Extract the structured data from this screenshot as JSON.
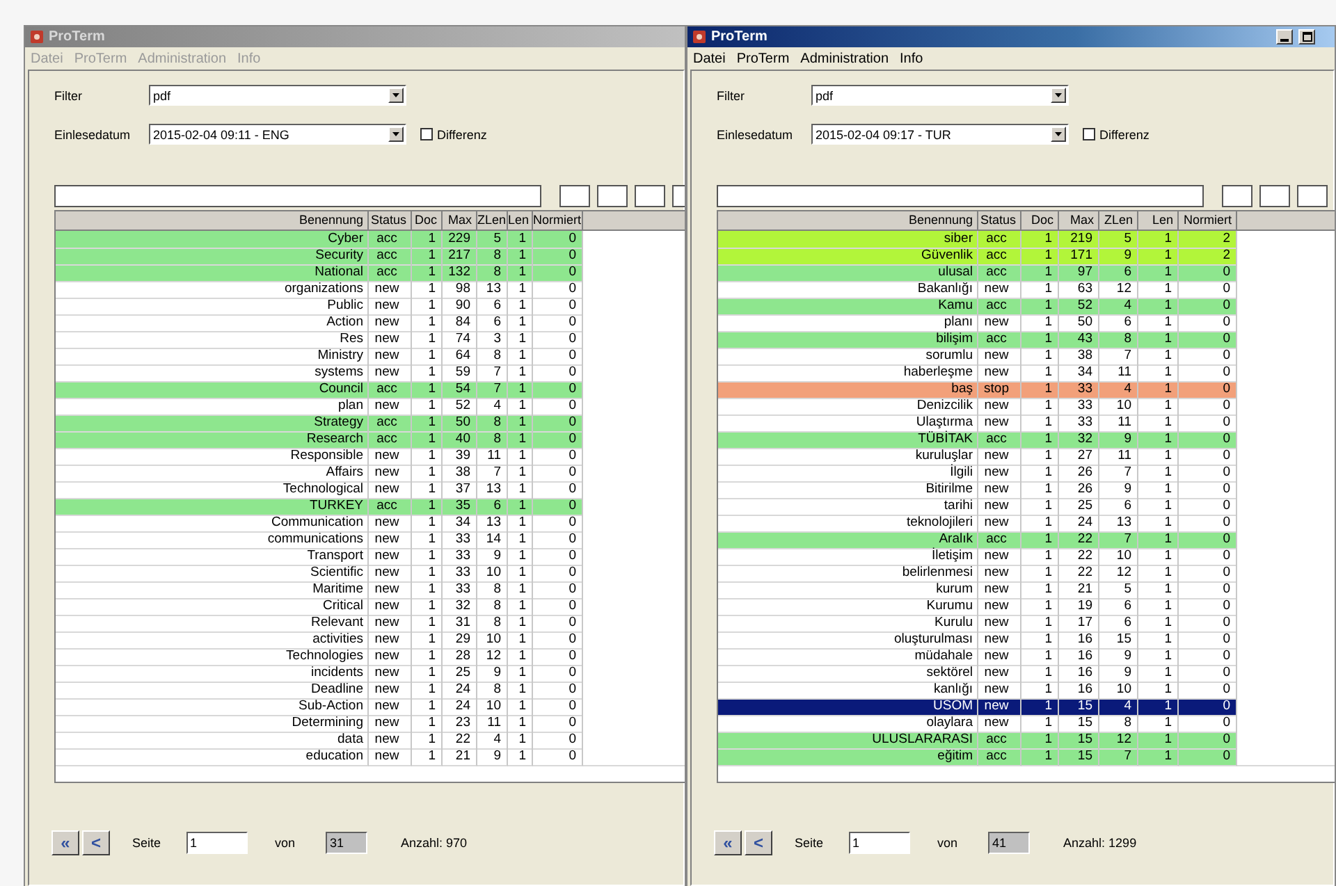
{
  "windows": [
    {
      "title": "ProTerm",
      "active": false,
      "menu": [
        "Datei",
        "ProTerm",
        "Administration",
        "Info"
      ],
      "filter": {
        "label": "Filter",
        "value": "pdf"
      },
      "date": {
        "label": "Einlesedatum",
        "value": "2015-02-04 09:11 - ENG"
      },
      "differenz": {
        "label": "Differenz",
        "checked": false
      },
      "columns": [
        "Benennung",
        "Status",
        "Doc",
        "Max",
        "ZLen",
        "Len",
        "Normiert"
      ],
      "rows": [
        {
          "cells": [
            "Cyber",
            "acc",
            "1",
            "229",
            "5",
            "1",
            "0"
          ],
          "color": "#8ee68e",
          "selected": false
        },
        {
          "cells": [
            "Security",
            "acc",
            "1",
            "217",
            "8",
            "1",
            "0"
          ],
          "color": "#8ee68e",
          "selected": false
        },
        {
          "cells": [
            "National",
            "acc",
            "1",
            "132",
            "8",
            "1",
            "0"
          ],
          "color": "#8ee68e",
          "selected": false
        },
        {
          "cells": [
            "organizations",
            "new",
            "1",
            "98",
            "13",
            "1",
            "0"
          ],
          "selected": false
        },
        {
          "cells": [
            "Public",
            "new",
            "1",
            "90",
            "6",
            "1",
            "0"
          ],
          "selected": false
        },
        {
          "cells": [
            "Action",
            "new",
            "1",
            "84",
            "6",
            "1",
            "0"
          ],
          "selected": false
        },
        {
          "cells": [
            "Res",
            "new",
            "1",
            "74",
            "3",
            "1",
            "0"
          ],
          "selected": false
        },
        {
          "cells": [
            "Ministry",
            "new",
            "1",
            "64",
            "8",
            "1",
            "0"
          ],
          "selected": false
        },
        {
          "cells": [
            "systems",
            "new",
            "1",
            "59",
            "7",
            "1",
            "0"
          ],
          "selected": false
        },
        {
          "cells": [
            "Council",
            "acc",
            "1",
            "54",
            "7",
            "1",
            "0"
          ],
          "color": "#8ee68e",
          "selected": false
        },
        {
          "cells": [
            "plan",
            "new",
            "1",
            "52",
            "4",
            "1",
            "0"
          ],
          "selected": false
        },
        {
          "cells": [
            "Strategy",
            "acc",
            "1",
            "50",
            "8",
            "1",
            "0"
          ],
          "color": "#8ee68e",
          "selected": false
        },
        {
          "cells": [
            "Research",
            "acc",
            "1",
            "40",
            "8",
            "1",
            "0"
          ],
          "color": "#8ee68e",
          "selected": false
        },
        {
          "cells": [
            "Responsible",
            "new",
            "1",
            "39",
            "11",
            "1",
            "0"
          ],
          "selected": false
        },
        {
          "cells": [
            "Affairs",
            "new",
            "1",
            "38",
            "7",
            "1",
            "0"
          ],
          "selected": false
        },
        {
          "cells": [
            "Technological",
            "new",
            "1",
            "37",
            "13",
            "1",
            "0"
          ],
          "selected": false
        },
        {
          "cells": [
            "TURKEY",
            "acc",
            "1",
            "35",
            "6",
            "1",
            "0"
          ],
          "color": "#8ee68e",
          "selected": false
        },
        {
          "cells": [
            "Communication",
            "new",
            "1",
            "34",
            "13",
            "1",
            "0"
          ],
          "selected": false
        },
        {
          "cells": [
            "communications",
            "new",
            "1",
            "33",
            "14",
            "1",
            "0"
          ],
          "selected": false
        },
        {
          "cells": [
            "Transport",
            "new",
            "1",
            "33",
            "9",
            "1",
            "0"
          ],
          "selected": false
        },
        {
          "cells": [
            "Scientific",
            "new",
            "1",
            "33",
            "10",
            "1",
            "0"
          ],
          "selected": false
        },
        {
          "cells": [
            "Maritime",
            "new",
            "1",
            "33",
            "8",
            "1",
            "0"
          ],
          "selected": false
        },
        {
          "cells": [
            "Critical",
            "new",
            "1",
            "32",
            "8",
            "1",
            "0"
          ],
          "selected": false
        },
        {
          "cells": [
            "Relevant",
            "new",
            "1",
            "31",
            "8",
            "1",
            "0"
          ],
          "selected": false
        },
        {
          "cells": [
            "activities",
            "new",
            "1",
            "29",
            "10",
            "1",
            "0"
          ],
          "selected": false
        },
        {
          "cells": [
            "Technologies",
            "new",
            "1",
            "28",
            "12",
            "1",
            "0"
          ],
          "selected": false
        },
        {
          "cells": [
            "incidents",
            "new",
            "1",
            "25",
            "9",
            "1",
            "0"
          ],
          "selected": false
        },
        {
          "cells": [
            "Deadline",
            "new",
            "1",
            "24",
            "8",
            "1",
            "0"
          ],
          "selected": false
        },
        {
          "cells": [
            "Sub-Action",
            "new",
            "1",
            "24",
            "10",
            "1",
            "0"
          ],
          "selected": false
        },
        {
          "cells": [
            "Determining",
            "new",
            "1",
            "23",
            "11",
            "1",
            "0"
          ],
          "selected": false
        },
        {
          "cells": [
            "data",
            "new",
            "1",
            "22",
            "4",
            "1",
            "0"
          ],
          "selected": false
        },
        {
          "cells": [
            "education",
            "new",
            "1",
            "21",
            "9",
            "1",
            "0"
          ],
          "selected": false
        }
      ],
      "nav": [
        "«",
        "<"
      ],
      "pager": {
        "page_label": "Seite",
        "page": "1",
        "of_label": "von",
        "total": "31",
        "count": "Anzahl: 970"
      }
    },
    {
      "title": "ProTerm",
      "active": true,
      "menu": [
        "Datei",
        "ProTerm",
        "Administration",
        "Info"
      ],
      "filter": {
        "label": "Filter",
        "value": "pdf"
      },
      "date": {
        "label": "Einlesedatum",
        "value": "2015-02-04 09:17 - TUR"
      },
      "differenz": {
        "label": "Differenz",
        "checked": false
      },
      "columns": [
        "Benennung",
        "Status",
        "Doc",
        "Max",
        "ZLen",
        "Len",
        "Normiert"
      ],
      "rows": [
        {
          "cells": [
            "siber",
            "acc",
            "1",
            "219",
            "5",
            "1",
            "2"
          ],
          "color": "#b2f53a",
          "selected": false
        },
        {
          "cells": [
            "Güvenlik",
            "acc",
            "1",
            "171",
            "9",
            "1",
            "2"
          ],
          "color": "#b2f53a",
          "selected": false
        },
        {
          "cells": [
            "ulusal",
            "acc",
            "1",
            "97",
            "6",
            "1",
            "0"
          ],
          "color": "#8ee68e",
          "selected": false
        },
        {
          "cells": [
            "Bakanlığı",
            "new",
            "1",
            "63",
            "12",
            "1",
            "0"
          ],
          "selected": false
        },
        {
          "cells": [
            "Kamu",
            "acc",
            "1",
            "52",
            "4",
            "1",
            "0"
          ],
          "color": "#8ee68e",
          "selected": false
        },
        {
          "cells": [
            "planı",
            "new",
            "1",
            "50",
            "6",
            "1",
            "0"
          ],
          "selected": false
        },
        {
          "cells": [
            "bilişim",
            "acc",
            "1",
            "43",
            "8",
            "1",
            "0"
          ],
          "color": "#8ee68e",
          "selected": false
        },
        {
          "cells": [
            "sorumlu",
            "new",
            "1",
            "38",
            "7",
            "1",
            "0"
          ],
          "selected": false
        },
        {
          "cells": [
            "haberleşme",
            "new",
            "1",
            "34",
            "11",
            "1",
            "0"
          ],
          "selected": false
        },
        {
          "cells": [
            "baş",
            "stop",
            "1",
            "33",
            "4",
            "1",
            "0"
          ],
          "color": "#f2a07a",
          "selected": false
        },
        {
          "cells": [
            "Denizcilik",
            "new",
            "1",
            "33",
            "10",
            "1",
            "0"
          ],
          "selected": false
        },
        {
          "cells": [
            "Ulaştırma",
            "new",
            "1",
            "33",
            "11",
            "1",
            "0"
          ],
          "selected": false
        },
        {
          "cells": [
            "TÜBİTAK",
            "acc",
            "1",
            "32",
            "9",
            "1",
            "0"
          ],
          "color": "#8ee68e",
          "selected": false
        },
        {
          "cells": [
            "kuruluşlar",
            "new",
            "1",
            "27",
            "11",
            "1",
            "0"
          ],
          "selected": false
        },
        {
          "cells": [
            "İlgili",
            "new",
            "1",
            "26",
            "7",
            "1",
            "0"
          ],
          "selected": false
        },
        {
          "cells": [
            "Bitirilme",
            "new",
            "1",
            "26",
            "9",
            "1",
            "0"
          ],
          "selected": false
        },
        {
          "cells": [
            "tarihi",
            "new",
            "1",
            "25",
            "6",
            "1",
            "0"
          ],
          "selected": false
        },
        {
          "cells": [
            "teknolojileri",
            "new",
            "1",
            "24",
            "13",
            "1",
            "0"
          ],
          "selected": false
        },
        {
          "cells": [
            "Aralık",
            "acc",
            "1",
            "22",
            "7",
            "1",
            "0"
          ],
          "color": "#8ee68e",
          "selected": false
        },
        {
          "cells": [
            "İletişim",
            "new",
            "1",
            "22",
            "10",
            "1",
            "0"
          ],
          "selected": false
        },
        {
          "cells": [
            "belirlenmesi",
            "new",
            "1",
            "22",
            "12",
            "1",
            "0"
          ],
          "selected": false
        },
        {
          "cells": [
            "kurum",
            "new",
            "1",
            "21",
            "5",
            "1",
            "0"
          ],
          "selected": false
        },
        {
          "cells": [
            "Kurumu",
            "new",
            "1",
            "19",
            "6",
            "1",
            "0"
          ],
          "selected": false
        },
        {
          "cells": [
            "Kurulu",
            "new",
            "1",
            "17",
            "6",
            "1",
            "0"
          ],
          "selected": false
        },
        {
          "cells": [
            "oluşturulması",
            "new",
            "1",
            "16",
            "15",
            "1",
            "0"
          ],
          "selected": false
        },
        {
          "cells": [
            "müdahale",
            "new",
            "1",
            "16",
            "9",
            "1",
            "0"
          ],
          "selected": false
        },
        {
          "cells": [
            "sektörel",
            "new",
            "1",
            "16",
            "9",
            "1",
            "0"
          ],
          "selected": false
        },
        {
          "cells": [
            "kanlığı",
            "new",
            "1",
            "16",
            "10",
            "1",
            "0"
          ],
          "selected": false
        },
        {
          "cells": [
            "USOM",
            "new",
            "1",
            "15",
            "4",
            "1",
            "0"
          ],
          "selected": true
        },
        {
          "cells": [
            "olaylara",
            "new",
            "1",
            "15",
            "8",
            "1",
            "0"
          ],
          "selected": false
        },
        {
          "cells": [
            "ULUSLARARASI",
            "acc",
            "1",
            "15",
            "12",
            "1",
            "0"
          ],
          "color": "#8ee68e",
          "selected": false
        },
        {
          "cells": [
            "eğitim",
            "acc",
            "1",
            "15",
            "7",
            "1",
            "0"
          ],
          "color": "#8ee68e",
          "selected": false
        }
      ],
      "nav": [
        "«",
        "<"
      ],
      "pager": {
        "page_label": "Seite",
        "page": "1",
        "of_label": "von",
        "total": "41",
        "count": "Anzahl: 1299"
      }
    }
  ]
}
